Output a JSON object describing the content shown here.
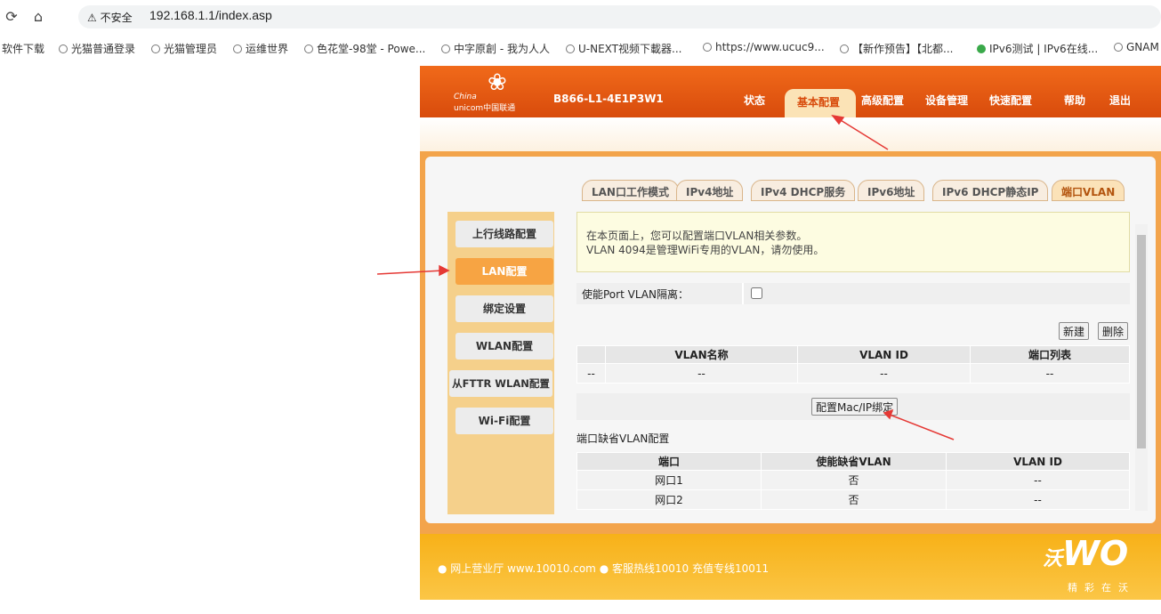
{
  "browser": {
    "insecure_label": "不安全",
    "url": "192.168.1.1/index.asp",
    "bookmarks": [
      "软件下载",
      "光猫普通登录",
      "光猫管理员",
      "运维世界",
      "色花堂-98堂 - Powe...",
      "中字原創 - 我为人人",
      "U-NEXT视频下載器...",
      "https://www.ucuc9...",
      "【新作预告】【北都...",
      "IPv6测试 | IPv6在线...",
      "GNAM"
    ]
  },
  "header": {
    "logo_line1": "China",
    "logo_line2": "unicom中国联通",
    "model": "B866-L1-4E1P3W1",
    "menu": [
      "状态",
      "基本配置",
      "高级配置",
      "设备管理",
      "快速配置",
      "帮助",
      "退出"
    ],
    "active_menu": "基本配置"
  },
  "tabs": [
    "LAN口工作模式",
    "IPv4地址",
    "IPv4 DHCP服务",
    "IPv6地址",
    "IPv6 DHCP静态IP",
    "端口VLAN"
  ],
  "active_tab": "端口VLAN",
  "sidebar": [
    "上行线路配置",
    "LAN配置",
    "绑定设置",
    "WLAN配置",
    "从FTTR WLAN配置",
    "Wi-Fi配置"
  ],
  "active_sidebar": "LAN配置",
  "content": {
    "notice_line1": "在本页面上，您可以配置端口VLAN相关参数。",
    "notice_line2": "VLAN 4094是管理WiFi专用的VLAN，请勿使用。",
    "enable_label": "使能Port VLAN隔离：",
    "new_button": "新建",
    "delete_button": "删除",
    "vlan_table": {
      "headers": [
        "",
        "VLAN名称",
        "VLAN ID",
        "端口列表"
      ],
      "row": [
        "--",
        "--",
        "--",
        "--"
      ]
    },
    "bind_button": "配置Mac/IP绑定",
    "default_vlan_title": "端口缺省VLAN配置",
    "default_table": {
      "headers": [
        "端口",
        "使能缺省VLAN",
        "VLAN ID"
      ],
      "rows": [
        [
          "网口1",
          "否",
          "--"
        ],
        [
          "网口2",
          "否",
          "--"
        ]
      ]
    }
  },
  "footer": {
    "text": "● 网上营业厅  www.10010.com ● 客服热线10010  充值专线10011",
    "brand": "沃",
    "brand_wo": "WO",
    "slogan": "精彩在沃"
  }
}
